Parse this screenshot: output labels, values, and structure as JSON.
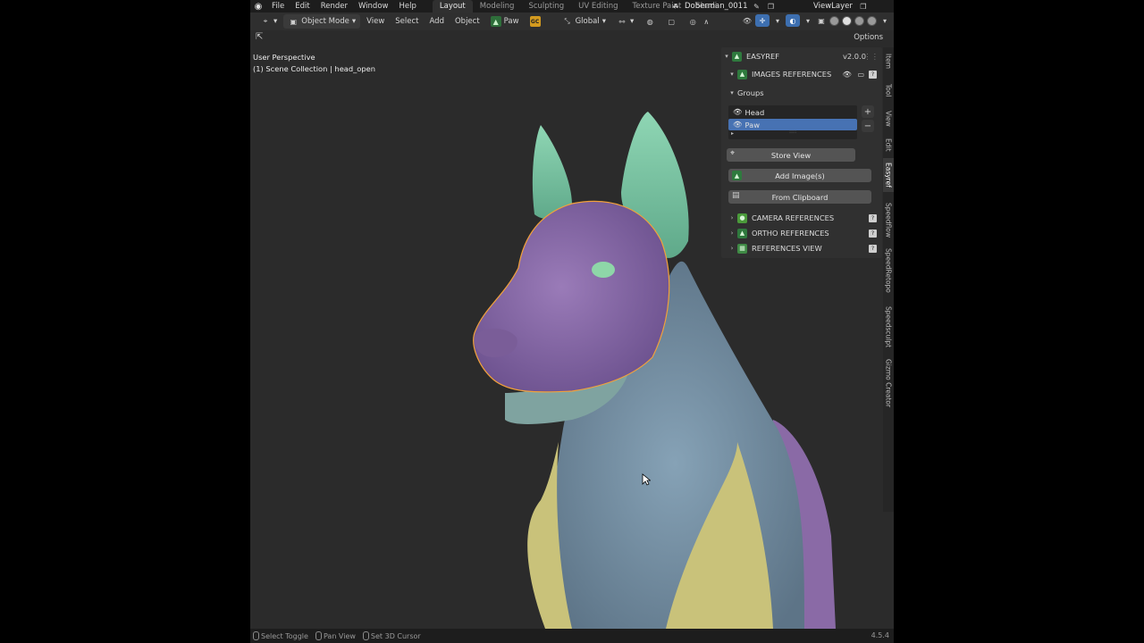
{
  "menubar": {
    "menus": [
      "File",
      "Edit",
      "Render",
      "Window",
      "Help"
    ],
    "workspaces": [
      "Layout",
      "Modeling",
      "Sculpting",
      "UV Editing",
      "Texture Paint",
      "Shadi"
    ],
    "active_workspace": "Layout",
    "scene_name": "Doberman_0011",
    "view_layer": "ViewLayer"
  },
  "header": {
    "mode": "Object Mode",
    "menus": [
      "View",
      "Select",
      "Add",
      "Object"
    ],
    "paw_label": "Paw",
    "gc_label": "GC",
    "transform_orientation": "Global",
    "options_label": "Options"
  },
  "viewport": {
    "perspective": "User Perspective",
    "collection": "(1) Scene Collection | head_open"
  },
  "panel": {
    "addon_title": "EASYREF",
    "version": "v2.0.0",
    "images_references": "IMAGES REFERENCES",
    "groups_label": "Groups",
    "groups": [
      {
        "name": "Head",
        "selected": false
      },
      {
        "name": "Paw",
        "selected": true
      }
    ],
    "store_view": "Store View",
    "add_images": "Add Image(s)",
    "from_clipboard": "From Clipboard",
    "camera_references": "CAMERA REFERENCES",
    "ortho_references": "ORTHO REFERENCES",
    "references_view": "REFERENCES VIEW",
    "help_glyph": "?"
  },
  "side_tabs": [
    "Item",
    "Tool",
    "View",
    "Edit",
    "Easyref",
    "Speedflow",
    "SpeedRetopo",
    "Speedsculpt",
    "Gizmo Creator"
  ],
  "active_side_tab": "Easyref",
  "statusbar": {
    "items": [
      "Select Toggle",
      "Pan View",
      "Set 3D Cursor"
    ],
    "version": "4.5.4"
  },
  "colors": {
    "accent_blue": "#4772b3",
    "head_purple": "#8a6aa6",
    "ears_green": "#7cc6a4",
    "body_blue": "#6f8aa0",
    "vest_yellow": "#c9c27a",
    "selection_outline": "#f2a13a"
  }
}
